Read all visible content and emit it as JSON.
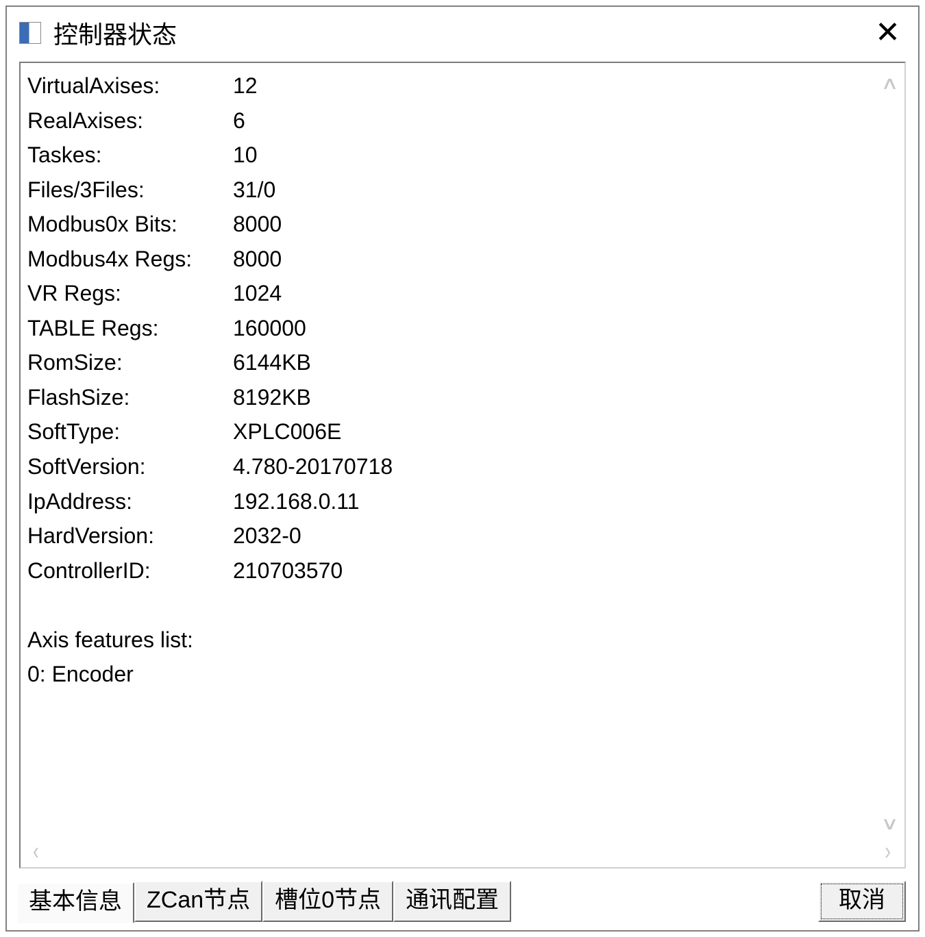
{
  "title": "控制器状态",
  "info_rows": [
    {
      "label": "VirtualAxises:",
      "value": "12"
    },
    {
      "label": "RealAxises:",
      "value": "6"
    },
    {
      "label": "Taskes:",
      "value": "10"
    },
    {
      "label": "Files/3Files:",
      "value": "31/0"
    },
    {
      "label": "Modbus0x Bits:",
      "value": "8000"
    },
    {
      "label": "Modbus4x Regs:",
      "value": "8000"
    },
    {
      "label": "VR Regs:",
      "value": "1024"
    },
    {
      "label": "TABLE Regs:",
      "value": "160000"
    },
    {
      "label": "RomSize:",
      "value": "6144KB"
    },
    {
      "label": "FlashSize:",
      "value": "8192KB"
    },
    {
      "label": "SoftType:",
      "value": "XPLC006E"
    },
    {
      "label": "SoftVersion:",
      "value": "4.780-20170718"
    },
    {
      "label": "IpAddress:",
      "value": "192.168.0.11"
    },
    {
      "label": "HardVersion:",
      "value": "2032-0"
    },
    {
      "label": "ControllerID:",
      "value": "210703570"
    }
  ],
  "axis_header": "Axis features list:",
  "axis_entries": [
    "0: Encoder"
  ],
  "tabs": [
    {
      "label": "基本信息",
      "active": true
    },
    {
      "label": "ZCan节点",
      "active": false
    },
    {
      "label": "槽位0节点",
      "active": false
    },
    {
      "label": "通讯配置",
      "active": false
    }
  ],
  "cancel_label": "取消"
}
